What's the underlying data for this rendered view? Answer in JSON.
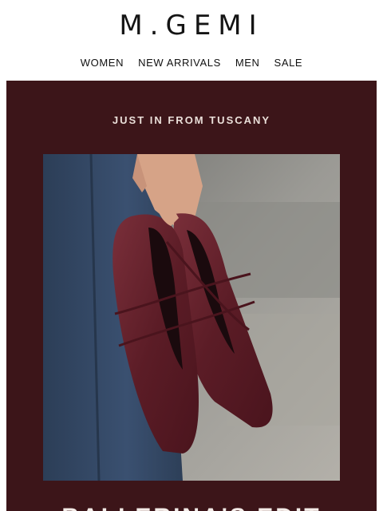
{
  "brand": {
    "logo_text": "M.GEMI"
  },
  "nav": {
    "items": [
      "WOMEN",
      "NEW ARRIVALS",
      "MEN",
      "SALE"
    ]
  },
  "hero": {
    "eyebrow": "JUST IN FROM TUSCANY",
    "headline": "BALLERINA'S EDIT",
    "background_color": "#3c1519",
    "image_alt": "Hand holding burgundy leather ballet flats with crossed elastic straps"
  }
}
